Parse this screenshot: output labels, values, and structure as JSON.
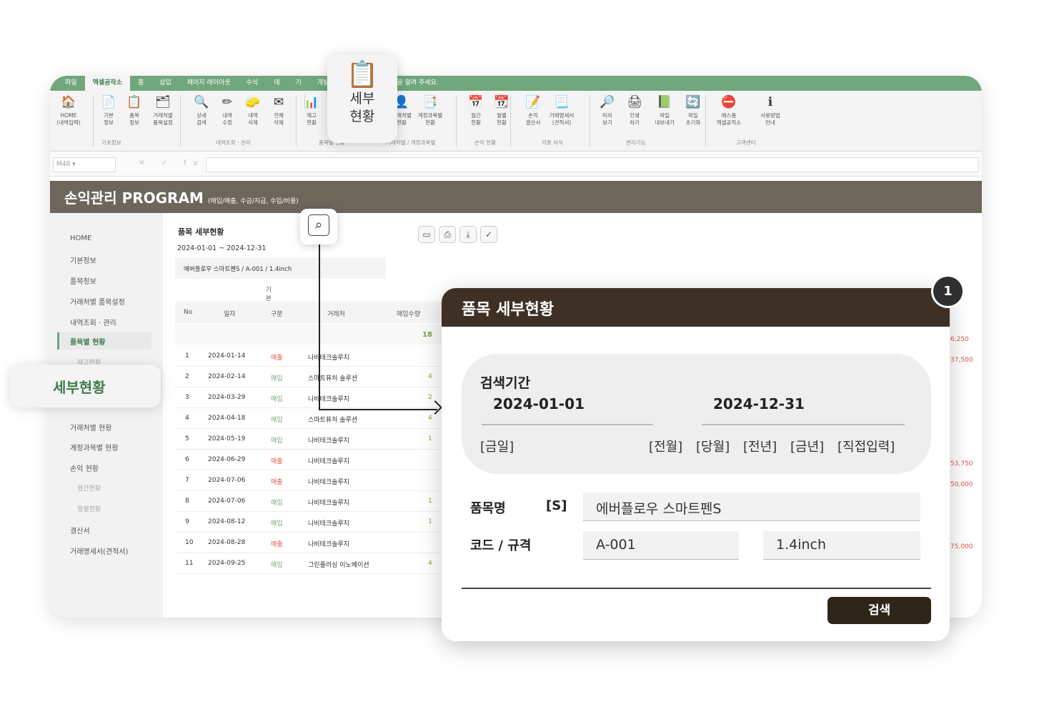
{
  "tabs": [
    "파일",
    "엑셀공작소",
    "홈",
    "삽입",
    "페이지 레이아웃",
    "수식",
    "데",
    "기",
    "개발 도구",
    "♀ 수행할 작업을 알려 주세요."
  ],
  "ribbon": {
    "buttons": [
      {
        "label": "HOME\n(내역입력)",
        "icon": "🏠"
      },
      {
        "label": "기본\n정보",
        "icon": "📄"
      },
      {
        "label": "품목\n정보",
        "icon": "📋"
      },
      {
        "label": "거래처별\n품목설정",
        "icon": "🗂"
      },
      {
        "label": "상세\n검색",
        "icon": "🔍"
      },
      {
        "label": "내역\n수정",
        "icon": "✏"
      },
      {
        "label": "내역\n삭제",
        "icon": "🧽"
      },
      {
        "label": "전체\n삭제",
        "icon": "✉"
      },
      {
        "label": "재고\n현황",
        "icon": "📊"
      },
      {
        "label": "거래처별\n현황",
        "icon": "👤"
      },
      {
        "label": "계정과목별\n현황",
        "icon": "📑"
      },
      {
        "label": "월간\n현황",
        "icon": "📅"
      },
      {
        "label": "월별\n현황",
        "icon": "📆"
      },
      {
        "label": "손익\n결산서",
        "icon": "📝"
      },
      {
        "label": "거래명세서\n(견적서)",
        "icon": "📃"
      },
      {
        "label": "미리\n보기",
        "icon": "🔎"
      },
      {
        "label": "인쇄\n하기",
        "icon": "🖨"
      },
      {
        "label": "파일\n내보내기",
        "icon": "📗"
      },
      {
        "label": "파일\n초기화",
        "icon": "🔄"
      },
      {
        "label": "에스폼\n엑셀공작소",
        "icon": "⛔"
      },
      {
        "label": "사용방법\n안내",
        "icon": "ℹ"
      }
    ],
    "groups": [
      "기초정보",
      "내역조회 · 관리",
      "품목별 현황",
      "거래처별 / 계정과목별",
      "손익 현황",
      "각종 서식",
      "편리기능",
      "고객센터"
    ]
  },
  "formula": {
    "cell": "M48",
    "fx": "✕  ✓  fx"
  },
  "banner": {
    "title": "손익관리 PROGRAM",
    "subtitle": "(매입/매출, 수금/지급, 수입/비용)"
  },
  "sidebar": {
    "items": [
      "HOME",
      "기본정보",
      "품목정보",
      "거래처별 품목설정",
      "내역조회 · 관리",
      "품목별 현황",
      "재고현황",
      "세부현황",
      "거래처별 현황",
      "계정과목별 현황",
      "손익 현황",
      "월간현황",
      "월별현황",
      "결산서",
      "거래명세서(견적서)"
    ]
  },
  "sheet": {
    "title": "품목 세부현황",
    "date_range": "2024-01-01 ~ 2024-12-31",
    "item_line": "에버플로우 스마트펜S / A-001 / 1.4inch",
    "group_label": "기본정보",
    "headers": [
      "No",
      "일자",
      "구분",
      "거래처",
      "매입수량"
    ],
    "sum_qty": "18",
    "rows": [
      {
        "no": "1",
        "date": "2024-01-14",
        "type": "매출",
        "client": "나비테크솔루지",
        "qty": ""
      },
      {
        "no": "2",
        "date": "2024-02-14",
        "type": "매입",
        "client": "스마트퓨처 솔루션",
        "qty": "4"
      },
      {
        "no": "3",
        "date": "2024-03-29",
        "type": "매입",
        "client": "나비테크솔루지",
        "qty": "2"
      },
      {
        "no": "4",
        "date": "2024-04-18",
        "type": "매입",
        "client": "스마트퓨처 솔루션",
        "qty": "4"
      },
      {
        "no": "5",
        "date": "2024-05-19",
        "type": "매입",
        "client": "나비테크솔루지",
        "qty": "1"
      },
      {
        "no": "6",
        "date": "2024-06-29",
        "type": "매출",
        "client": "나비테크솔루지",
        "qty": ""
      },
      {
        "no": "7",
        "date": "2024-07-06",
        "type": "매출",
        "client": "나비테크솔루지",
        "qty": ""
      },
      {
        "no": "8",
        "date": "2024-07-06",
        "type": "매입",
        "client": "나비테크솔루지",
        "qty": "1"
      },
      {
        "no": "9",
        "date": "2024-08-12",
        "type": "매입",
        "client": "나비테크솔루지",
        "qty": "1"
      },
      {
        "no": "10",
        "date": "2024-08-28",
        "type": "매출",
        "client": "나비테크솔루지",
        "qty": ""
      },
      {
        "no": "11",
        "date": "2024-09-25",
        "type": "매입",
        "client": "그린플러싱 이노베이션",
        "qty": "4"
      }
    ],
    "right_values": [
      "6,250",
      "37,500",
      "53,750",
      "50,000",
      "75,000"
    ]
  },
  "toolbar_icons": [
    "monitor-icon",
    "printer-icon",
    "download-icon",
    "check-icon"
  ],
  "float_button": {
    "label": "세부\n현황"
  },
  "float_pill": {
    "label": "세부현황"
  },
  "dialog": {
    "title": "품목 세부현황",
    "badge": "1",
    "period_label": "검색기간",
    "start_date": "2024-01-01",
    "end_date": "2024-12-31",
    "today_btn": "[금일]",
    "quick_btns": [
      "[전월]",
      "[당월]",
      "[전년]",
      "[금년]",
      "[직접입력]"
    ],
    "item_label": "품목명",
    "item_mode": "[S]",
    "item_value": "에버플로우 스마트펜S",
    "code_label": "코드 / 규격",
    "code_value": "A-001",
    "spec_value": "1.4inch",
    "search_btn": "검색"
  },
  "colors": {
    "accent": "#71a77c",
    "banner": "#6d665b",
    "dialog_header": "#3e3024",
    "search_button": "#2f2418"
  }
}
